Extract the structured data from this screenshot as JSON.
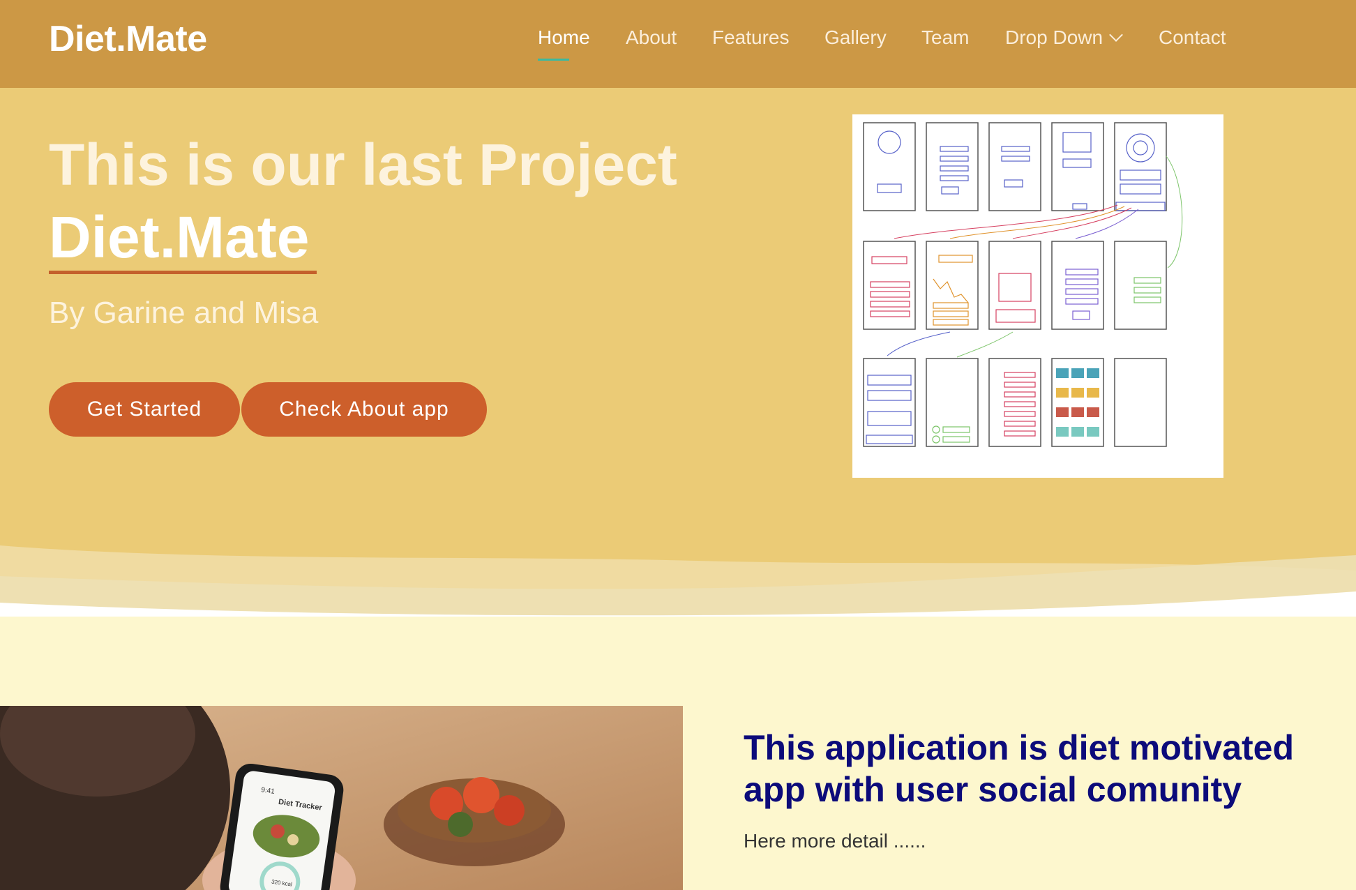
{
  "brand": "Diet.Mate",
  "nav": {
    "items": [
      "Home",
      "About",
      "Features",
      "Gallery",
      "Team",
      "Drop Down",
      "Contact"
    ],
    "active": "Home"
  },
  "hero": {
    "title": "This is our last Project",
    "brand": "Diet.Mate",
    "subtitle": "By Garine and Misa",
    "buttons": {
      "get_started": "Get Started",
      "check_about": "Check About app"
    }
  },
  "about": {
    "heading": "This application is diet motivated app with user social comunity",
    "text": "Here more detail ......",
    "phone_title": "Diet Tracker",
    "phone_kcal": "320 kcal",
    "phone_time": "9:41"
  },
  "colors": {
    "header_bg": "#cc9845",
    "hero_bg": "#ebcb76",
    "button_bg": "#cd5f2b",
    "section_bg": "#fdf7ce",
    "heading_color": "#0c0b7a",
    "nav_active_underline": "#3bb9a0"
  }
}
